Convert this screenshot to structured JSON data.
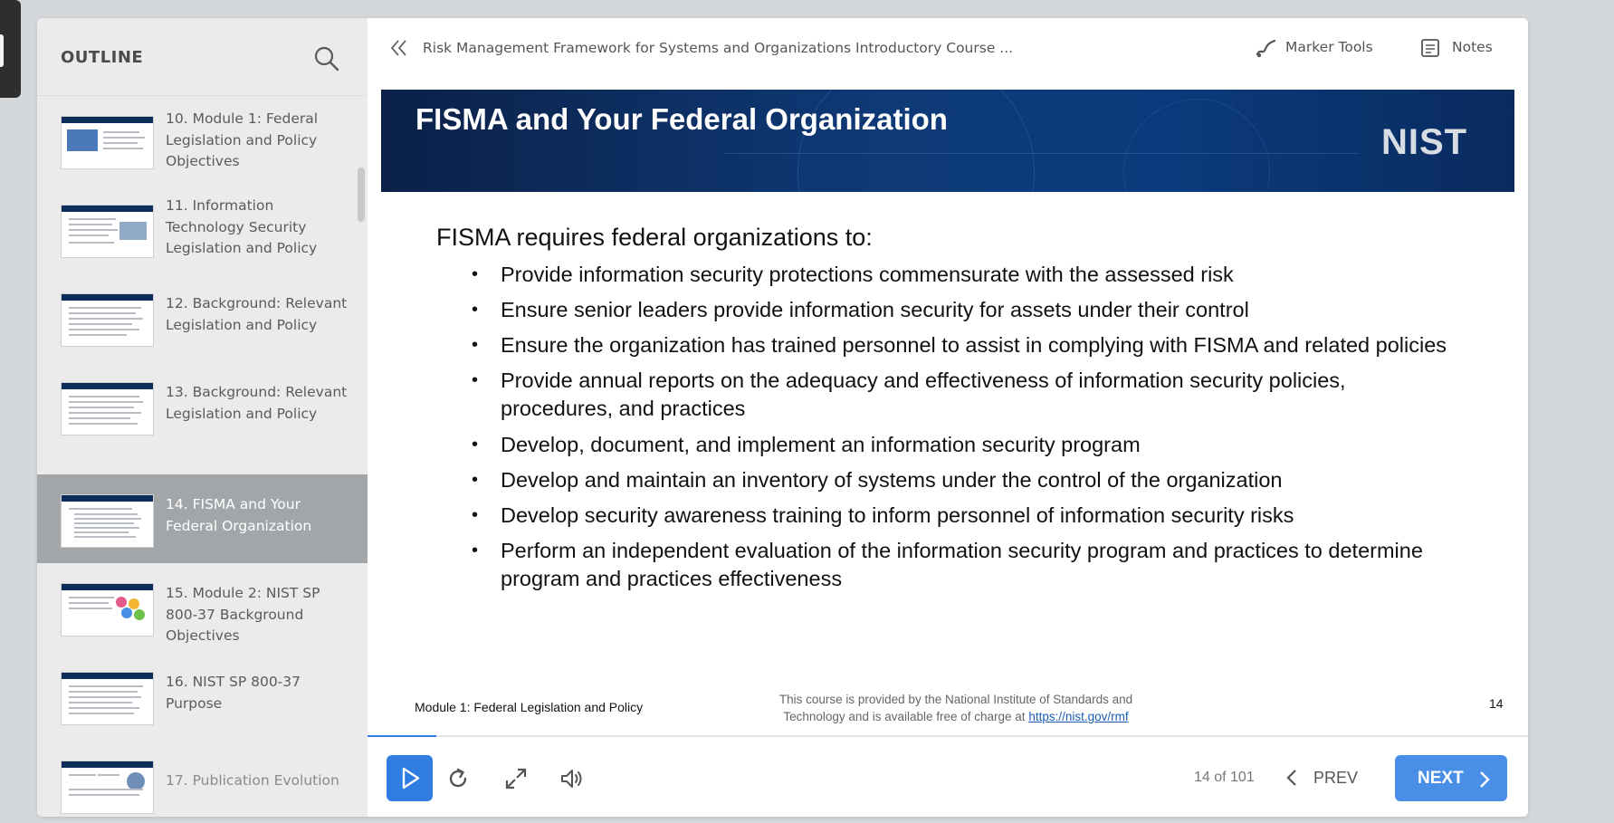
{
  "outline": {
    "title": "OUTLINE",
    "items": [
      {
        "label": "10. Module 1: Federal Legislation and Policy Objectives",
        "active": false
      },
      {
        "label": "11. Information Technology Security Legislation and Policy",
        "active": false
      },
      {
        "label": "12. Background: Relevant Legislation and Policy",
        "active": false
      },
      {
        "label": "13. Background: Relevant Legislation and Policy",
        "active": false
      },
      {
        "label": "14. FISMA and Your Federal Organization",
        "active": true
      },
      {
        "label": "15. Module 2: NIST SP 800-37 Background Objectives",
        "active": false
      },
      {
        "label": "16. NIST SP 800-37 Purpose",
        "active": false
      },
      {
        "label": "17. Publication Evolution",
        "active": false
      }
    ]
  },
  "topbar": {
    "course_title": "Risk Management Framework for Systems and Organizations Introductory Course ...",
    "marker_tools_label": "Marker Tools",
    "notes_label": "Notes"
  },
  "slide": {
    "title": "FISMA and Your Federal Organization",
    "logo_text": "NIST",
    "intro": "FISMA requires federal organizations to:",
    "bullets": [
      "Provide information security protections commensurate with the assessed risk",
      "Ensure senior leaders provide information security for assets under their control",
      "Ensure the organization has trained personnel to assist in complying with FISMA and related policies",
      "Provide annual reports on the adequacy and effectiveness of information security policies, procedures, and practices",
      "Develop, document, and implement an information security program",
      "Develop and maintain an inventory of systems under the control of the organization",
      "Develop security awareness training to inform personnel of information security risks",
      "Perform an independent evaluation of the information security program and practices to determine program and practices effectiveness"
    ],
    "footer_left": "Module 1: Federal Legislation and Policy",
    "footer_center_line1": "This course is provided by the National Institute of Standards and",
    "footer_center_line2_prefix": "Technology and is available free of charge at ",
    "footer_link": "https://nist.gov/rmf",
    "slide_number": "14"
  },
  "controls": {
    "progress_fraction": 0.059,
    "page_count": "14 of 101",
    "prev_label": "PREV",
    "next_label": "NEXT",
    "accent_color": "#2f7de1"
  },
  "icons": [
    "search-icon",
    "double-chevron-left-icon",
    "marker-icon",
    "notes-icon",
    "play-icon",
    "replay-icon",
    "expand-icon",
    "volume-icon",
    "chevron-left-icon",
    "chevron-right-icon"
  ]
}
